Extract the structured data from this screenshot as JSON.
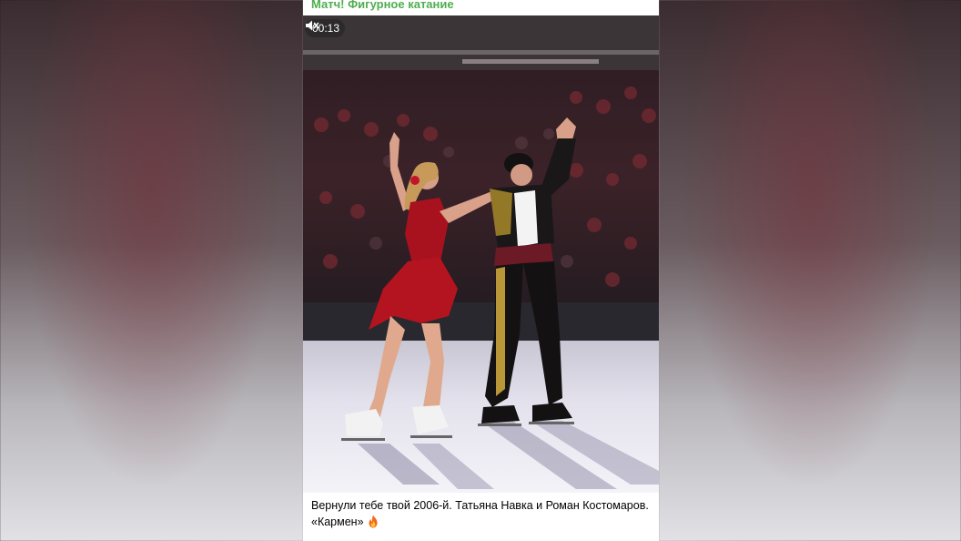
{
  "post": {
    "channel_name": "Матч! Фигурное катание",
    "video": {
      "time": "00:13",
      "muted": true
    },
    "caption": {
      "line1": "Вернули тебе твой 2006-й. Татьяна Навка и Роман Костомаров.",
      "line2": "«Кармен»",
      "emoji_icon": "fire-icon"
    }
  },
  "colors": {
    "channel_name": "#4fae4e",
    "time_pill_bg": "#282828",
    "caption_text": "#000000"
  }
}
